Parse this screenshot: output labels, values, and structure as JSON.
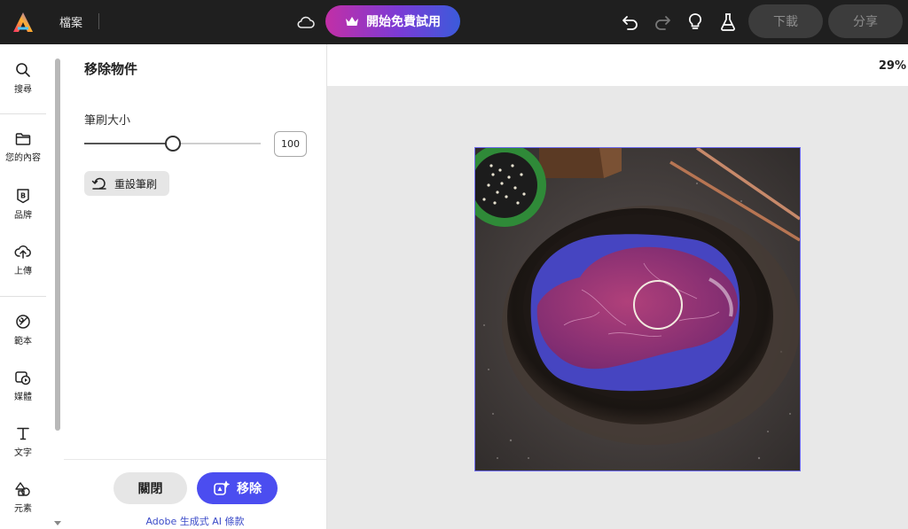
{
  "topbar": {
    "file_menu": "檔案",
    "trial_button": "開始免費試用",
    "download_button": "下載",
    "share_button": "分享",
    "icons": [
      "adobe-express-logo",
      "cloud-icon",
      "crown-icon",
      "undo-icon",
      "redo-icon",
      "lightbulb-icon",
      "flask-icon"
    ]
  },
  "leftrail": {
    "items": [
      {
        "label": "搜尋",
        "icon": "search-icon"
      },
      {
        "label": "您的內容",
        "icon": "folder-icon"
      },
      {
        "label": "品牌",
        "icon": "brand-icon"
      },
      {
        "label": "上傳",
        "icon": "upload-icon"
      },
      {
        "label": "範本",
        "icon": "template-icon"
      },
      {
        "label": "媒體",
        "icon": "media-icon"
      },
      {
        "label": "文字",
        "icon": "text-icon"
      },
      {
        "label": "元素",
        "icon": "elements-icon"
      }
    ]
  },
  "panel": {
    "title": "移除物件",
    "brush_size_label": "筆刷大小",
    "brush_size_value": "100",
    "brush_slider_fraction": 0.5,
    "reset_button": "重設筆刷",
    "close_button": "關閉",
    "remove_button": "移除",
    "ai_terms_link": "Adobe 生成式 AI 條款"
  },
  "canvas": {
    "zoom": "29%",
    "selection_color": "#6f6cf0"
  },
  "colors": {
    "topbar_bg": "#1f1f1f",
    "primary": "#4b4df0",
    "link": "#3b4bc8"
  }
}
